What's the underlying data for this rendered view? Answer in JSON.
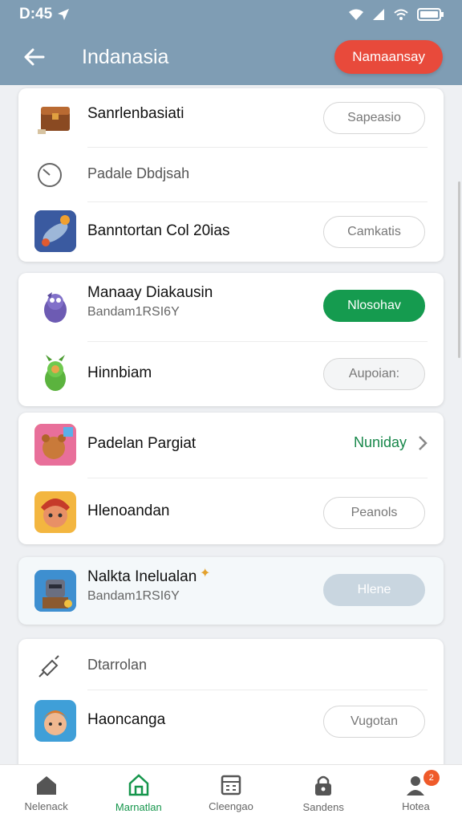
{
  "status": {
    "time": "D:45"
  },
  "header": {
    "title": "Indanasia",
    "action_label": "Namaansay"
  },
  "cards": [
    {
      "rows": [
        {
          "name": "Sanrlenbasiati",
          "button": "Sapeasio"
        },
        {
          "name": "Padale Dbdjsah"
        },
        {
          "name": "Banntortan Col 20ias",
          "button": "Camkatis"
        }
      ]
    },
    {
      "rows": [
        {
          "name": "Manaay Diakausin",
          "sub": "Bandam1RSI6Y",
          "button": "Nlosohav"
        },
        {
          "name": "Hinnbiam",
          "button": "Aupoian:"
        }
      ]
    },
    {
      "rows": [
        {
          "name": "Padelan Pargiat",
          "link": "Nuniday"
        },
        {
          "name": "Hlenoandan",
          "button": "Peanols"
        }
      ]
    },
    {
      "rows": [
        {
          "name": "Nalkta Inelualan",
          "sub": "Bandam1RSI6Y",
          "button": "Hlene"
        }
      ]
    },
    {
      "rows": [
        {
          "name": "Dtarrolan"
        },
        {
          "name": "Haoncanga",
          "button": "Vugotan"
        }
      ]
    }
  ],
  "tabs": [
    {
      "label": "Nelenack"
    },
    {
      "label": "Marnatlan"
    },
    {
      "label": "Cleengao"
    },
    {
      "label": "Sandens"
    },
    {
      "label": "Hotea",
      "badge": "2"
    }
  ],
  "colors": {
    "appbar": "#7f9db4",
    "accent_red": "#e84a3b",
    "accent_green": "#159b4f"
  }
}
